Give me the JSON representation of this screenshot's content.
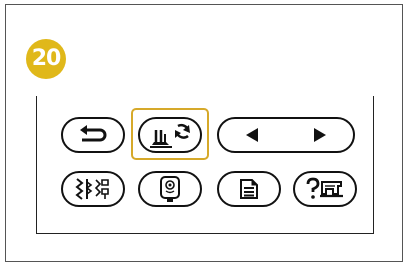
{
  "step": {
    "number": "20"
  },
  "colors": {
    "badge": "#e0b81a",
    "highlight": "#d6a92a",
    "stroke": "#111111"
  },
  "panel": {
    "row1": [
      {
        "name": "back-button",
        "icon": "back-arrow-icon"
      },
      {
        "name": "presser-foot-needle-exchange-button",
        "icon": "presser-foot-rotate-icon",
        "highlighted": true
      },
      {
        "name": "page-navigation-button",
        "icons": [
          "left-triangle-icon",
          "right-triangle-icon"
        ]
      }
    ],
    "row2": [
      {
        "name": "utility-stitch-button",
        "icon": "stitch-patterns-icon"
      },
      {
        "name": "embroidery-button",
        "icon": "embroidery-hoop-icon"
      },
      {
        "name": "settings-button",
        "icon": "document-list-icon"
      },
      {
        "name": "help-button",
        "icon": "help-machine-icon"
      }
    ]
  }
}
